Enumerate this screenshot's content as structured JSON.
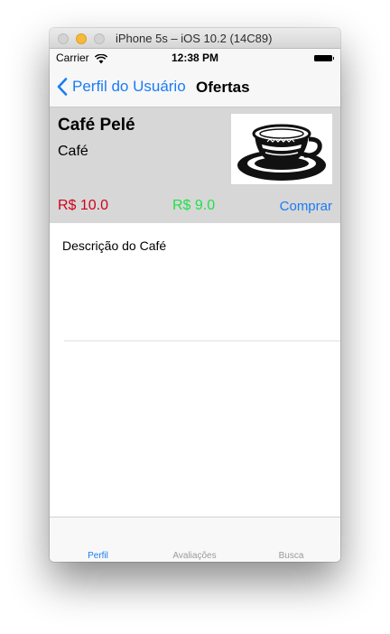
{
  "window": {
    "title": "iPhone 5s – iOS 10.2 (14C89)"
  },
  "status_bar": {
    "carrier": "Carrier",
    "time": "12:38 PM"
  },
  "nav": {
    "back_label": "Perfil do Usuário",
    "title": "Ofertas"
  },
  "offer": {
    "name": "Café Pelé",
    "type": "Café",
    "price_original": "R$ 10.0",
    "price_offer": "R$ 9.0",
    "buy_label": "Comprar",
    "description": "Descrição do Café"
  },
  "tabs": [
    {
      "label": "Perfil",
      "selected": true
    },
    {
      "label": "Avaliações",
      "selected": false
    },
    {
      "label": "Busca",
      "selected": false
    }
  ],
  "colors": {
    "accent": "#1a7cf5",
    "price_original": "#d0021b",
    "price_offer": "#21e04b",
    "card_background": "#d7d7d7"
  }
}
